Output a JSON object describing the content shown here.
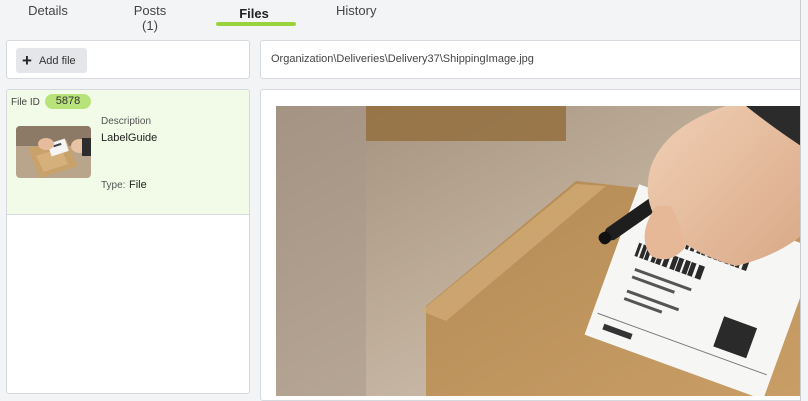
{
  "tabs": [
    {
      "label": "Details"
    },
    {
      "label": "Posts (1)"
    },
    {
      "label": "Files"
    },
    {
      "label": "History"
    }
  ],
  "active_tab": "Files",
  "toolbar": {
    "add_file_label": "Add file"
  },
  "path": "Organization\\Deliveries\\Delivery37\\ShippingImage.jpg",
  "file": {
    "id_label": "File ID",
    "id": "5878",
    "description_label": "Description",
    "description": "LabelGuide",
    "type_label": "Type:",
    "type": "File"
  },
  "colors": {
    "accent": "#9ad23b",
    "badge": "#b8e27a",
    "selected_bg": "#f2fbe8"
  },
  "preview_label": {
    "brand": "NCO",
    "from": "From: Nuname Co.",
    "to": "To: ANOTHER COMPANY",
    "fragile": "FRAGILE"
  }
}
